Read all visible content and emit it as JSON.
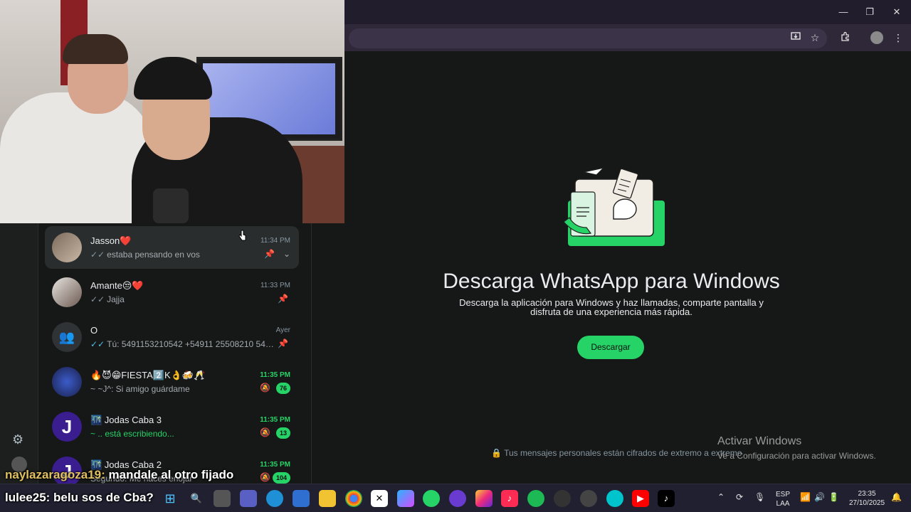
{
  "browser": {
    "minimize": "—",
    "restore": "❐",
    "close": "✕"
  },
  "chats": [
    {
      "name": "Jasson❤️",
      "time": "11:34 PM",
      "preview": "estaba pensando en vos"
    },
    {
      "name": "Amante😒❤️",
      "time": "11:33 PM",
      "preview": "Jajja"
    },
    {
      "name": "O",
      "time": "Ayer",
      "preview": "Tú: 5491153210542 +54911 25508210 54911..."
    },
    {
      "name": "🔥😈😁FIESTA2️⃣K👌🍻🥂",
      "time": "11:35 PM",
      "preview": "~ ~J^: Si amigo guárdame",
      "badge": "76"
    },
    {
      "name": "🌃 Jodas Caba 3",
      "time": "11:35 PM",
      "preview": "~ .. está escribiendo...",
      "badge": "13"
    },
    {
      "name": "🌃 Jodas Caba 2",
      "time": "11:35 PM",
      "preview": "Segundo: Me haces enojar",
      "badge": "104"
    }
  ],
  "promo": {
    "title": "Descarga WhatsApp para Windows",
    "subtitle_line1": "Descarga la aplicación para Windows y haz llamadas, comparte pantalla y",
    "subtitle_line2": "disfruta de una experiencia más rápida.",
    "button": "Descargar",
    "encrypted": "Tus mensajes personales están cifrados de extremo a extremo"
  },
  "activate_windows": {
    "title": "Activar Windows",
    "subtitle": "Ve a Configuración para activar Windows."
  },
  "stream_chat": [
    {
      "user": "naylazaragoza19:",
      "text": "mandale al otro fijado"
    },
    {
      "user": "lulee25:",
      "text": "belu sos de Cba?"
    }
  ],
  "tray": {
    "lang_top": "ESP",
    "lang_bottom": "LAA",
    "time": "23:35",
    "date": "27/10/2025"
  },
  "colors": {
    "accent": "#25d366",
    "background": "#161717"
  }
}
